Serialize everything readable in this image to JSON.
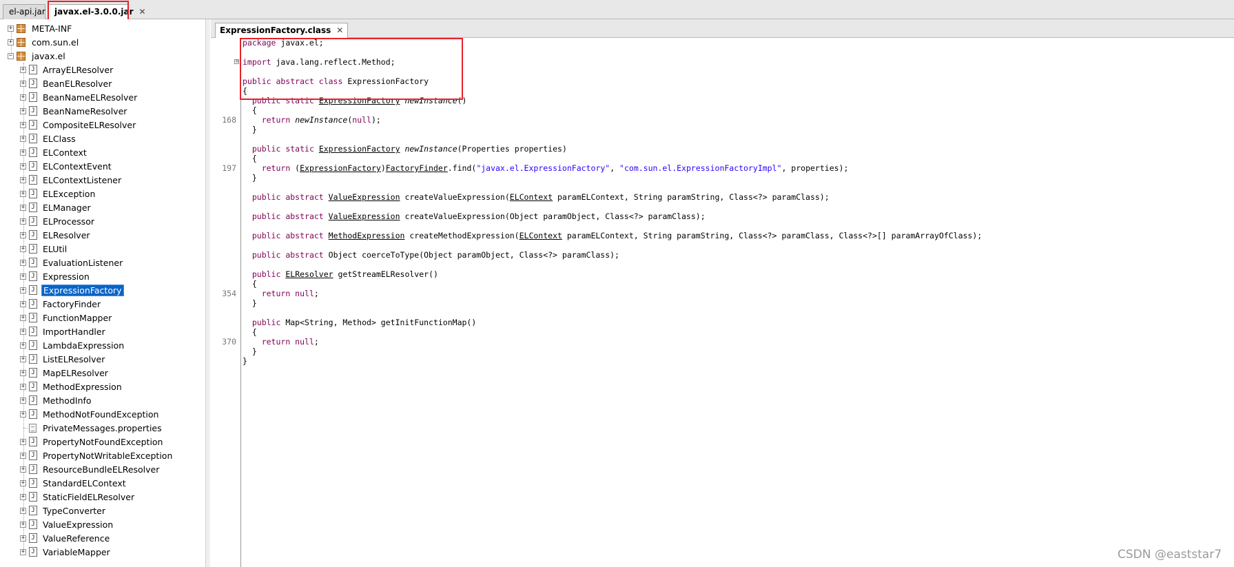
{
  "jar_tabs": [
    {
      "label": "el-api.jar",
      "active": false
    },
    {
      "label": "javax.el-3.0.0.jar",
      "active": true
    }
  ],
  "tree": {
    "roots": [
      "META-INF",
      "com.sun.el",
      "javax.el"
    ],
    "children": [
      "ArrayELResolver",
      "BeanELResolver",
      "BeanNameELResolver",
      "BeanNameResolver",
      "CompositeELResolver",
      "ELClass",
      "ELContext",
      "ELContextEvent",
      "ELContextListener",
      "ELException",
      "ELManager",
      "ELProcessor",
      "ELResolver",
      "ELUtil",
      "EvaluationListener",
      "Expression",
      "ExpressionFactory",
      "FactoryFinder",
      "FunctionMapper",
      "ImportHandler",
      "LambdaExpression",
      "ListELResolver",
      "MapELResolver",
      "MethodExpression",
      "MethodInfo",
      "MethodNotFoundException",
      "PrivateMessages.properties",
      "PropertyNotFoundException",
      "PropertyNotWritableException",
      "ResourceBundleELResolver",
      "StandardELContext",
      "StaticFieldELResolver",
      "TypeConverter",
      "ValueExpression",
      "ValueReference",
      "VariableMapper"
    ],
    "selected": "ExpressionFactory",
    "properties_file": "PrivateMessages.properties"
  },
  "editor": {
    "tab_label": "ExpressionFactory.class",
    "line_numbers": [
      {
        "row": 8,
        "label": "168"
      },
      {
        "row": 13,
        "label": "197"
      },
      {
        "row": 26,
        "label": "354"
      },
      {
        "row": 31,
        "label": "370"
      }
    ],
    "code": [
      [
        [
          "kw",
          "package"
        ],
        [
          "t",
          " javax.el;"
        ]
      ],
      [],
      [
        [
          "kw",
          "import"
        ],
        [
          "t",
          " java.lang.reflect.Method;"
        ]
      ],
      [],
      [
        [
          "kw",
          "public abstract class"
        ],
        [
          "t",
          " ExpressionFactory"
        ]
      ],
      [
        [
          "t",
          "{"
        ]
      ],
      [
        [
          "t",
          "  "
        ],
        [
          "kw",
          "public static"
        ],
        [
          "t",
          " "
        ],
        [
          "u",
          "ExpressionFactory"
        ],
        [
          "t",
          " "
        ],
        [
          "it",
          "newInstance"
        ],
        [
          "t",
          "()"
        ]
      ],
      [
        [
          "t",
          "  {"
        ]
      ],
      [
        [
          "t",
          "    "
        ],
        [
          "kw",
          "return"
        ],
        [
          "t",
          " "
        ],
        [
          "it",
          "newInstance"
        ],
        [
          "t",
          "("
        ],
        [
          "kw",
          "null"
        ],
        [
          "t",
          ");"
        ]
      ],
      [
        [
          "t",
          "  }"
        ]
      ],
      [],
      [
        [
          "t",
          "  "
        ],
        [
          "kw",
          "public static"
        ],
        [
          "t",
          " "
        ],
        [
          "u",
          "ExpressionFactory"
        ],
        [
          "t",
          " "
        ],
        [
          "it",
          "newInstance"
        ],
        [
          "t",
          "(Properties properties)"
        ]
      ],
      [
        [
          "t",
          "  {"
        ]
      ],
      [
        [
          "t",
          "    "
        ],
        [
          "kw",
          "return"
        ],
        [
          "t",
          " ("
        ],
        [
          "u",
          "ExpressionFactory"
        ],
        [
          "t",
          ")"
        ],
        [
          "u",
          "FactoryFinder"
        ],
        [
          "t",
          ".find("
        ],
        [
          "str",
          "\"javax.el.ExpressionFactory\""
        ],
        [
          "t",
          ", "
        ],
        [
          "str",
          "\"com.sun.el.ExpressionFactoryImpl\""
        ],
        [
          "t",
          ", properties);"
        ]
      ],
      [
        [
          "t",
          "  }"
        ]
      ],
      [],
      [
        [
          "t",
          "  "
        ],
        [
          "kw",
          "public abstract"
        ],
        [
          "t",
          " "
        ],
        [
          "u",
          "ValueExpression"
        ],
        [
          "t",
          " createValueExpression("
        ],
        [
          "u",
          "ELContext"
        ],
        [
          "t",
          " paramELContext, String paramString, Class<?> paramClass);"
        ]
      ],
      [],
      [
        [
          "t",
          "  "
        ],
        [
          "kw",
          "public abstract"
        ],
        [
          "t",
          " "
        ],
        [
          "u",
          "ValueExpression"
        ],
        [
          "t",
          " createValueExpression(Object paramObject, Class<?> paramClass);"
        ]
      ],
      [],
      [
        [
          "t",
          "  "
        ],
        [
          "kw",
          "public abstract"
        ],
        [
          "t",
          " "
        ],
        [
          "u",
          "MethodExpression"
        ],
        [
          "t",
          " createMethodExpression("
        ],
        [
          "u",
          "ELContext"
        ],
        [
          "t",
          " paramELContext, String paramString, Class<?> paramClass, Class<?>[] paramArrayOfClass);"
        ]
      ],
      [],
      [
        [
          "t",
          "  "
        ],
        [
          "kw",
          "public abstract"
        ],
        [
          "t",
          " Object coerceToType(Object paramObject, Class<?> paramClass);"
        ]
      ],
      [],
      [
        [
          "t",
          "  "
        ],
        [
          "kw",
          "public"
        ],
        [
          "t",
          " "
        ],
        [
          "u",
          "ELResolver"
        ],
        [
          "t",
          " getStreamELResolver()"
        ]
      ],
      [
        [
          "t",
          "  {"
        ]
      ],
      [
        [
          "t",
          "    "
        ],
        [
          "kw",
          "return null"
        ],
        [
          "t",
          ";"
        ]
      ],
      [
        [
          "t",
          "  }"
        ]
      ],
      [],
      [
        [
          "t",
          "  "
        ],
        [
          "kw",
          "public"
        ],
        [
          "t",
          " Map<String, Method> getInitFunctionMap()"
        ]
      ],
      [
        [
          "t",
          "  {"
        ]
      ],
      [
        [
          "t",
          "    "
        ],
        [
          "kw",
          "return null"
        ],
        [
          "t",
          ";"
        ]
      ],
      [
        [
          "t",
          "  }"
        ]
      ],
      [
        [
          "t",
          "}"
        ]
      ]
    ]
  },
  "watermark": "CSDN @eaststar7",
  "colors": {
    "highlight_box": "#e8202a",
    "selection": "#0a64c8",
    "keyword": "#7f0055",
    "string": "#2a00ff"
  }
}
